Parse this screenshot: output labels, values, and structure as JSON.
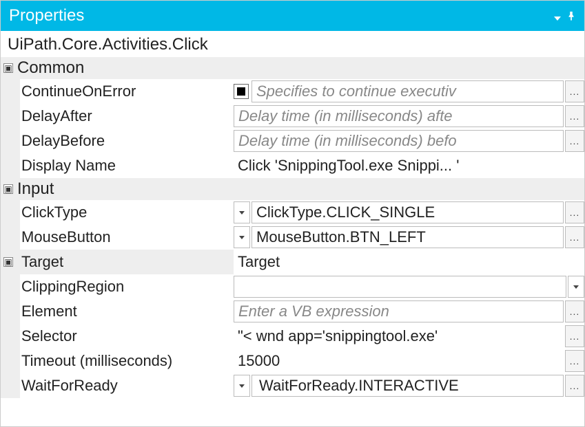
{
  "panel": {
    "title": "Properties"
  },
  "typeName": "UiPath.Core.Activities.Click",
  "categories": {
    "common": {
      "label": "Common",
      "rows": {
        "continueOnError": {
          "label": "ContinueOnError",
          "placeholder": "Specifies to continue executiv"
        },
        "delayAfter": {
          "label": "DelayAfter",
          "placeholder": "Delay time (in milliseconds) afte"
        },
        "delayBefore": {
          "label": "DelayBefore",
          "placeholder": "Delay time (in milliseconds) befo"
        },
        "displayName": {
          "label": "Display Name",
          "value": "Click 'SnippingTool.exe Snippi... '"
        }
      }
    },
    "input": {
      "label": "Input",
      "rows": {
        "clickType": {
          "label": "ClickType",
          "value": "ClickType.CLICK_SINGLE"
        },
        "mouseButton": {
          "label": "MouseButton",
          "value": "MouseButton.BTN_LEFT"
        }
      }
    },
    "target": {
      "label": "Target",
      "value": "Target",
      "rows": {
        "clippingRegion": {
          "label": "ClippingRegion"
        },
        "element": {
          "label": "Element",
          "placeholder": "Enter a VB expression"
        },
        "selector": {
          "label": "Selector",
          "value": "\"< wnd app='snippingtool.exe' "
        },
        "timeout": {
          "label": "Timeout (milliseconds)",
          "value": "15000"
        },
        "waitForReady": {
          "label": "WaitForReady",
          "value": "WaitForReady.INTERACTIVE"
        }
      }
    }
  }
}
